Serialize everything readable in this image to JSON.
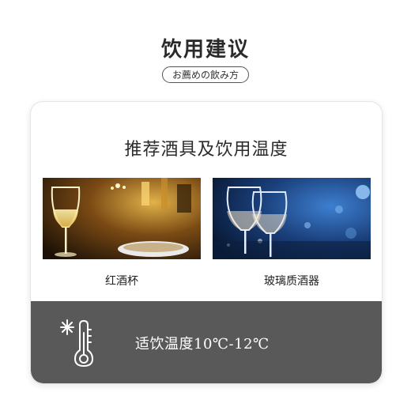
{
  "header": {
    "title": "饮用建议",
    "subtitle": "お薦めの飲み方"
  },
  "card": {
    "title": "推荐酒具及饮用温度",
    "glasses": [
      {
        "label": "红酒杯"
      },
      {
        "label": "玻璃质酒器"
      }
    ],
    "temperature": {
      "text": "适饮温度10℃-12℃",
      "icon": "thermometer-snowflake-icon"
    }
  },
  "colors": {
    "accent_bar": "#595959",
    "text": "#2b2b2b"
  }
}
